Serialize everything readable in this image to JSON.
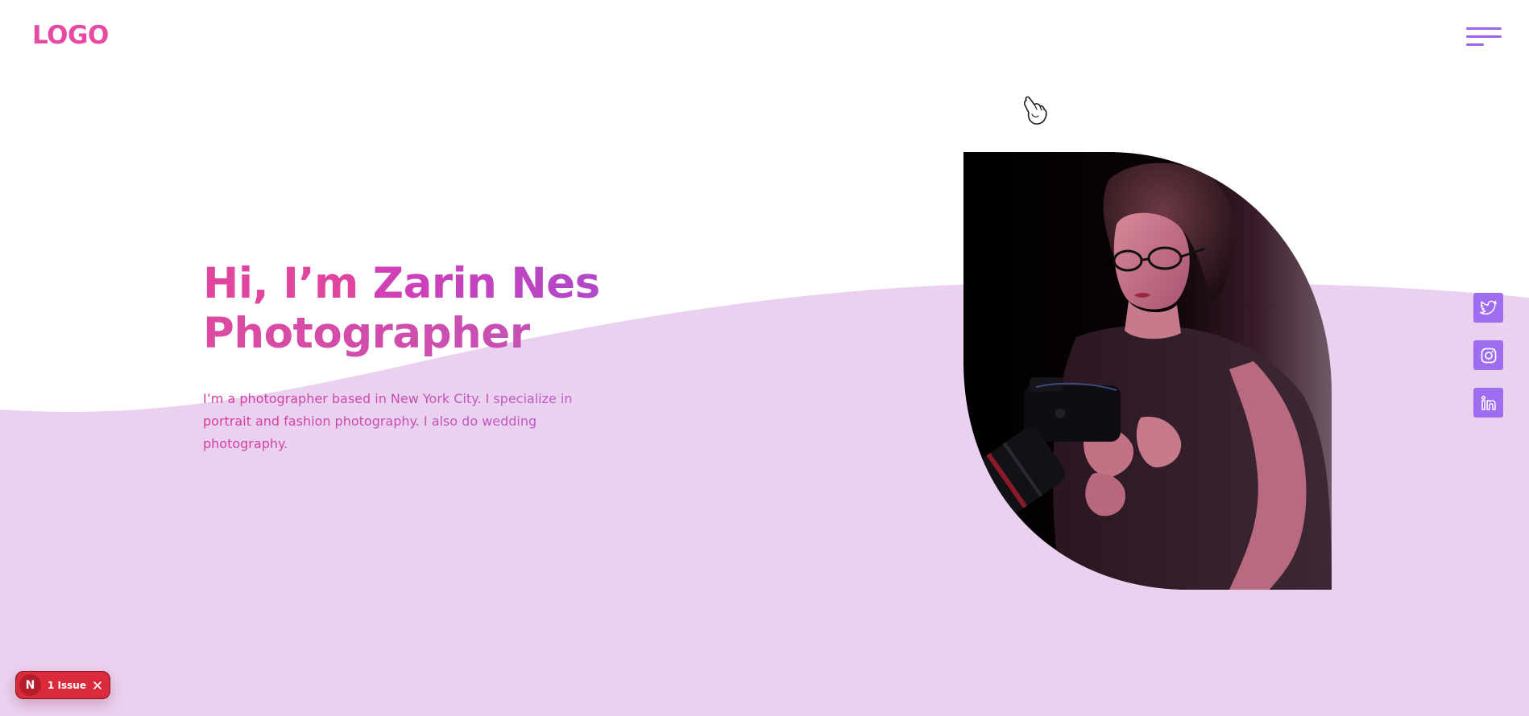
{
  "header": {
    "logo_text": "LOGO",
    "menu_icon": "hamburger-menu-icon"
  },
  "hero": {
    "greeting": "Hi, I’m ",
    "name": "Zarin Nes",
    "role": "Photographer",
    "bio": "I’m a photographer based in New York City. I specialize in portrait and fashion photography. I also do wedding photography."
  },
  "social": [
    {
      "name": "Twitter",
      "icon": "twitter-icon"
    },
    {
      "name": "Instagram",
      "icon": "instagram-icon"
    },
    {
      "name": "LinkedIn",
      "icon": "linkedin-icon"
    }
  ],
  "dev_overlay": {
    "logo_letter": "N",
    "issue_label": "1 Issue",
    "close_icon": "close-icon"
  },
  "colors": {
    "brand_pink": "#e64aa2",
    "accent_purple": "#9e6df0",
    "wave_lavender": "#ebd1f0",
    "badge_red": "#d92b3a"
  }
}
